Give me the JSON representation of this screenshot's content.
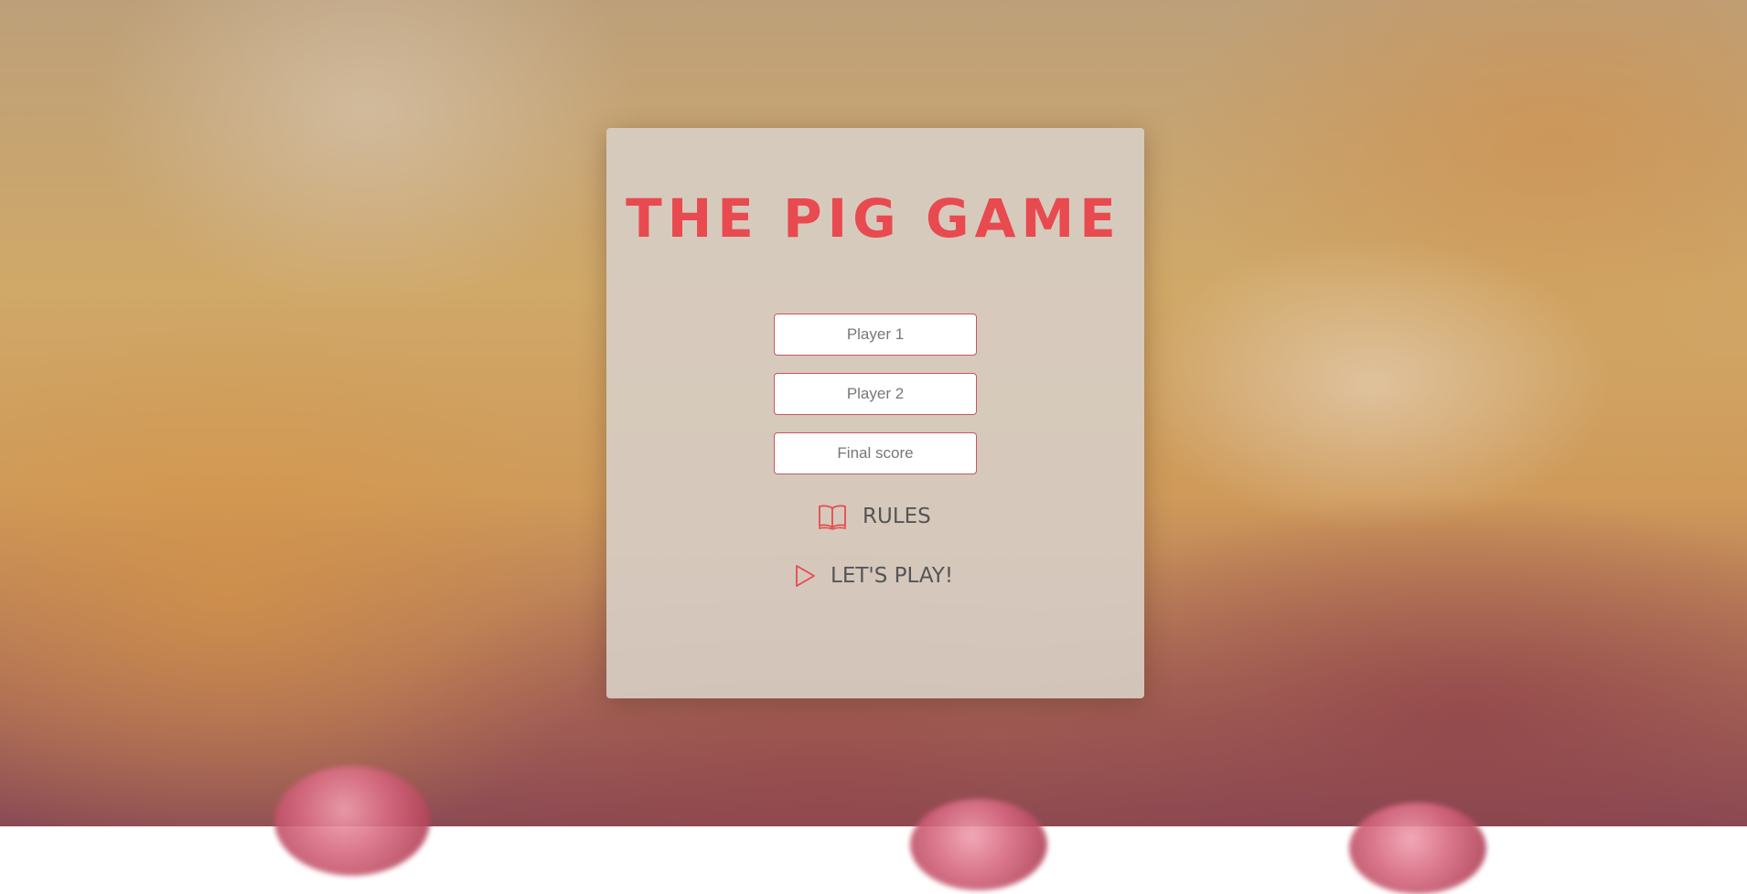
{
  "game": {
    "title": "THE PIG GAME"
  },
  "setup": {
    "player1_placeholder": "Player 1",
    "player2_placeholder": "Player 2",
    "final_score_placeholder": "Final score"
  },
  "menu": {
    "rules_label": "RULES",
    "rules_icon": "book-icon",
    "play_label": "LET'S PLAY!",
    "play_icon": "play-icon"
  },
  "colors": {
    "accent": "#e84a50",
    "text": "#555555",
    "card": "#d7cdc3"
  }
}
